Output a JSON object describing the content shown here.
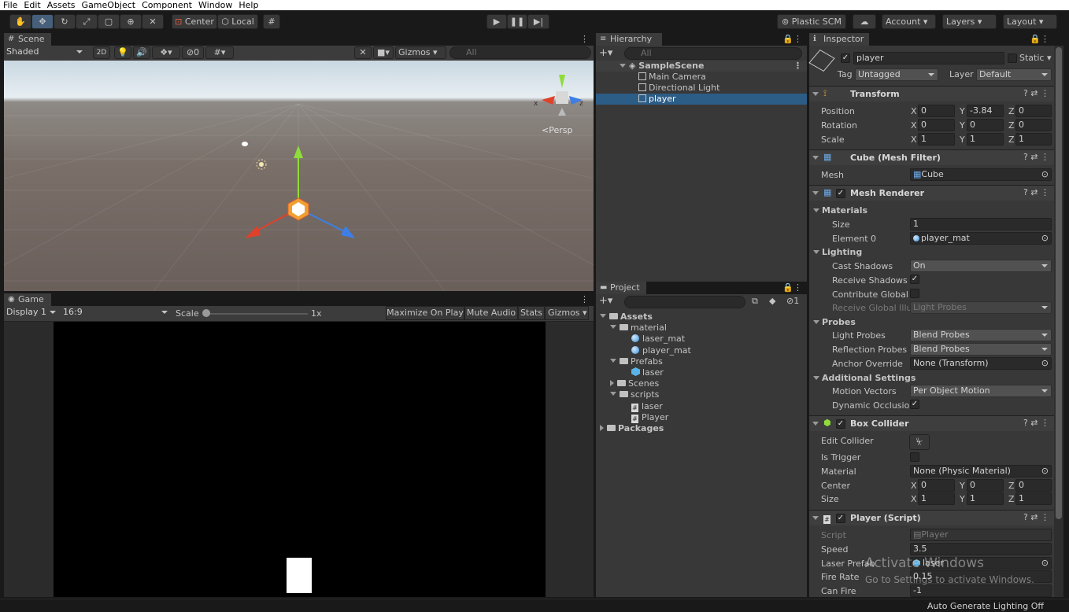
{
  "menu": [
    "File",
    "Edit",
    "Assets",
    "GameObject",
    "Component",
    "Window",
    "Help"
  ],
  "toolbar": {
    "center_label": "Center",
    "local_label": "Local",
    "plastic_label": "Plastic SCM",
    "account_label": "Account",
    "layers_label": "Layers",
    "layout_label": "Layout"
  },
  "scene": {
    "tab": "Scene",
    "shading": "Shaded",
    "mode_2d": "2D",
    "hidden_count": "0",
    "gizmos": "Gizmos",
    "search_placeholder": "All",
    "persp": "Persp",
    "axis_x": "x",
    "axis_z": "z"
  },
  "game": {
    "tab": "Game",
    "display": "Display 1",
    "aspect": "16:9",
    "scale_label": "Scale",
    "scale_value": "1x",
    "maximize": "Maximize On Play",
    "mute": "Mute Audio",
    "stats": "Stats",
    "gizmos": "Gizmos"
  },
  "hierarchy": {
    "tab": "Hierarchy",
    "search_placeholder": "All",
    "scene_name": "SampleScene",
    "items": [
      "Main Camera",
      "Directional Light",
      "player"
    ]
  },
  "project": {
    "tab": "Project",
    "count": "1",
    "tree": [
      {
        "label": "Assets",
        "kind": "folder",
        "depth": 0
      },
      {
        "label": "material",
        "kind": "folder",
        "depth": 1
      },
      {
        "label": "laser_mat",
        "kind": "material",
        "depth": 2
      },
      {
        "label": "player_mat",
        "kind": "material",
        "depth": 2
      },
      {
        "label": "Prefabs",
        "kind": "folder",
        "depth": 1
      },
      {
        "label": "laser",
        "kind": "prefab",
        "depth": 2
      },
      {
        "label": "Scenes",
        "kind": "folder",
        "depth": 1
      },
      {
        "label": "scripts",
        "kind": "folder",
        "depth": 1
      },
      {
        "label": "laser",
        "kind": "script",
        "depth": 2
      },
      {
        "label": "Player",
        "kind": "script",
        "depth": 2
      },
      {
        "label": "Packages",
        "kind": "folder",
        "depth": 0
      }
    ]
  },
  "inspector": {
    "tab": "Inspector",
    "object_name": "player",
    "static_label": "Static",
    "tag_label": "Tag",
    "tag_value": "Untagged",
    "layer_label": "Layer",
    "layer_value": "Default",
    "transform": {
      "title": "Transform",
      "position_label": "Position",
      "position": [
        "0",
        "-3.84",
        "0"
      ],
      "rotation_label": "Rotation",
      "rotation": [
        "0",
        "0",
        "0"
      ],
      "scale_label": "Scale",
      "scale": [
        "1",
        "1",
        "1"
      ]
    },
    "mesh_filter": {
      "title": "Cube (Mesh Filter)",
      "mesh_label": "Mesh",
      "mesh_value": "Cube"
    },
    "mesh_renderer": {
      "title": "Mesh Renderer",
      "materials": "Materials",
      "size_label": "Size",
      "size_value": "1",
      "element0_label": "Element 0",
      "element0_value": "player_mat",
      "lighting": "Lighting",
      "cast_shadows_label": "Cast Shadows",
      "cast_shadows_value": "On",
      "receive_shadows_label": "Receive Shadows",
      "contribute_gi_label": "Contribute Global Il",
      "receive_gi_label": "Receive Global Illur",
      "receive_gi_value": "Light Probes",
      "probes": "Probes",
      "light_probes_label": "Light Probes",
      "light_probes_value": "Blend Probes",
      "reflection_probes_label": "Reflection Probes",
      "reflection_probes_value": "Blend Probes",
      "anchor_label": "Anchor Override",
      "anchor_value": "None (Transform)",
      "additional": "Additional Settings",
      "motion_vectors_label": "Motion Vectors",
      "motion_vectors_value": "Per Object Motion",
      "dynamic_occlusion_label": "Dynamic Occlusion"
    },
    "box_collider": {
      "title": "Box Collider",
      "edit_label": "Edit Collider",
      "trigger_label": "Is Trigger",
      "material_label": "Material",
      "material_value": "None (Physic Material)",
      "center_label": "Center",
      "center": [
        "0",
        "0",
        "0"
      ],
      "size_label": "Size",
      "size": [
        "1",
        "1",
        "1"
      ]
    },
    "player_script": {
      "title": "Player (Script)",
      "script_label": "Script",
      "script_value": "Player",
      "speed_label": "Speed",
      "speed_value": "3.5",
      "laser_label": "Laser Prefab",
      "laser_value": "laser",
      "firerate_label": "Fire Rate",
      "firerate_value": "0.15",
      "canfire_label": "Can Fire",
      "canfire_value": "-1"
    }
  },
  "status": {
    "right": "Auto Generate Lighting Off"
  },
  "watermark": {
    "line1": "Activate Windows",
    "line2": "Go to Settings to activate Windows."
  }
}
